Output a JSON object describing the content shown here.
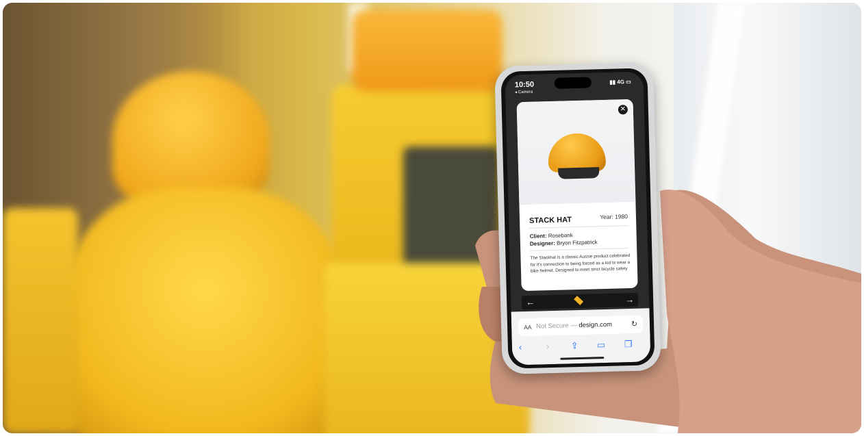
{
  "status": {
    "time": "10:50",
    "back_app": "◂ Camera",
    "network": "4G"
  },
  "card": {
    "title": "STACK HAT",
    "year": "Year: 1980",
    "client_label": "Client:",
    "client": "Rosebank",
    "designer_label": "Designer:",
    "designer": "Bryon Fitzpatrick",
    "description": "The Stackhat is a classic Aussie product celebrated for it's connection to being forced as a kid to wear a bike helmet. Designed to meet strict bicycle safety"
  },
  "safari": {
    "aa": "AA",
    "not_secure": "Not Secure — ",
    "host": "design.com"
  },
  "colors": {
    "accent_yellow": "#f2b324",
    "safari_blue": "#2a7bf6"
  }
}
